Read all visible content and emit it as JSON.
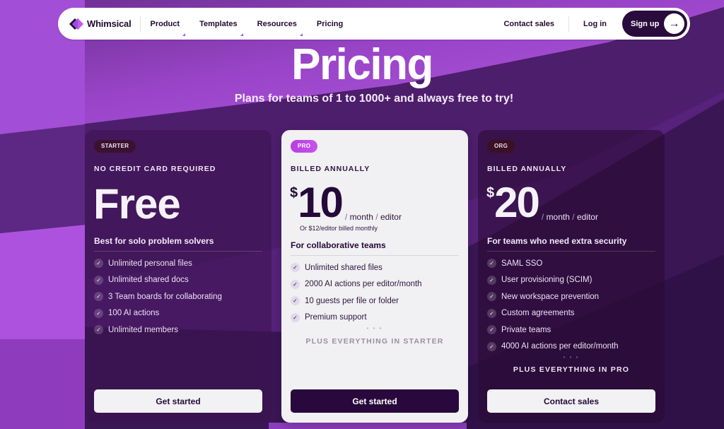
{
  "colors": {
    "brand_dark": "#2a0b3d",
    "accent_purple": "#b04de0",
    "bg_light_purple": "#a64fd8",
    "bg_dark_purple": "#3b1855",
    "pro_badge": "#c04ae8"
  },
  "nav": {
    "logo_text": "Whimsical",
    "logo_icon": "whimsical-diamond-logo",
    "links": [
      {
        "label": "Product",
        "has_dropdown": true
      },
      {
        "label": "Templates",
        "has_dropdown": true
      },
      {
        "label": "Resources",
        "has_dropdown": true
      },
      {
        "label": "Pricing",
        "has_dropdown": false
      }
    ],
    "contact_sales": "Contact sales",
    "log_in": "Log in",
    "sign_up": "Sign up",
    "sign_up_icon": "arrow-right-icon"
  },
  "hero": {
    "title": "Pricing",
    "subtitle": "Plans for teams of 1 to 1000+ and always free to try!"
  },
  "plans": [
    {
      "badge": "STARTER",
      "eyebrow": "NO CREDIT CARD REQUIRED",
      "price_text": "Free",
      "tagline": "Best for solo problem solvers",
      "features": [
        "Unlimited personal files",
        "Unlimited shared docs",
        "3 Team boards for collaborating",
        "100 AI actions",
        "Unlimited members"
      ],
      "cta": "Get started"
    },
    {
      "badge": "PRO",
      "eyebrow": "BILLED ANNUALLY",
      "currency": "$",
      "amount": "10",
      "per_month": "month",
      "per_editor": "editor",
      "monthly_note": "Or $12/editor billed monthly",
      "tagline": "For collaborative teams",
      "features": [
        "Unlimited shared files",
        "2000 AI actions per editor/month",
        "10 guests per file or folder",
        "Premium support"
      ],
      "dots": "• • •",
      "plus": "PLUS EVERYTHING IN STARTER",
      "cta": "Get started"
    },
    {
      "badge": "ORG",
      "eyebrow": "BILLED ANNUALLY",
      "currency": "$",
      "amount": "20",
      "per_month": "month",
      "per_editor": "editor",
      "tagline": "For teams who need extra security",
      "features": [
        "SAML SSO",
        "User provisioning (SCIM)",
        "New workspace prevention",
        "Custom agreements",
        "Private teams",
        "4000 AI actions per editor/month"
      ],
      "dots": "• • •",
      "plus": "PLUS EVERYTHING IN PRO",
      "cta": "Contact sales"
    }
  ]
}
